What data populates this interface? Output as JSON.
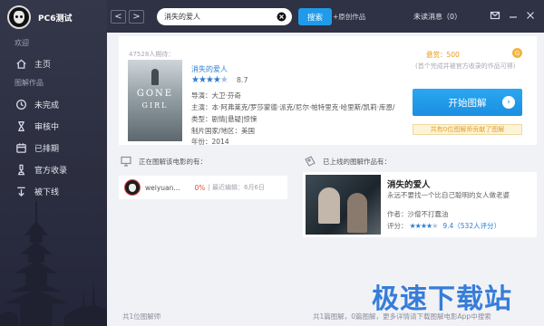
{
  "sidebar": {
    "username": "PC6测试",
    "welcome_label": "欢迎",
    "home_label": "主页",
    "graphic_label": "图解作品",
    "items": [
      {
        "label": "未完成",
        "icon": "clock-icon"
      },
      {
        "label": "审核中",
        "icon": "hourglass-icon"
      },
      {
        "label": "已排期",
        "icon": "calendar-icon"
      },
      {
        "label": "官方收录",
        "icon": "trophy-icon"
      },
      {
        "label": "被下线",
        "icon": "down-arrow-icon"
      }
    ]
  },
  "topbar": {
    "back_label": "<",
    "forward_label": ">",
    "search_value": "消失的爱人",
    "search_button": "搜索",
    "post_link": "+原创作品",
    "unread": "未读消息（0）"
  },
  "movie": {
    "wait_count": "47528人期待：",
    "title": "消失的爱人",
    "rating": "8.7",
    "star_value": 4.5,
    "poster_text_1": "GONE",
    "poster_text_2": "GIRL",
    "director": "导演：大卫·芬奇",
    "cast": "主演：本·阿弗莱克/罗莎蒙德·派克/尼尔·帕特里克·哈里斯/凯莉·库恩/...",
    "genre": "类型：剧情|悬疑|惊悚",
    "country": "制片国家/地区：美国",
    "year": "年份：2014",
    "reward": "悬赏：500",
    "coin_symbol": "G",
    "reward_note": "(首个完成并被官方收录的作品可得)",
    "start_button": "开始图解",
    "start_arrow": "›",
    "warning": "共有0位图解师贡献了图解"
  },
  "in_progress": {
    "header": "正在图解该电影的有：",
    "user": "weiyuan...",
    "percent": "0%",
    "recent_edit": "| 最近编辑：6月6日"
  },
  "works": {
    "header": "已上线的图解作品有：",
    "title": "消失的爱人",
    "subtitle": "永远不要找一个比自己聪明的女人做老婆",
    "author": "作者：沙僧不打蠢油",
    "score_label": "评分：",
    "score_value": "9.4（532人评分）",
    "star_value": 4.5
  },
  "footer": {
    "left": "共1位图解师",
    "right": "共1篇图解，0篇图解，更多详情请下载图解电影App中搜索"
  },
  "watermark": "极速下载站"
}
